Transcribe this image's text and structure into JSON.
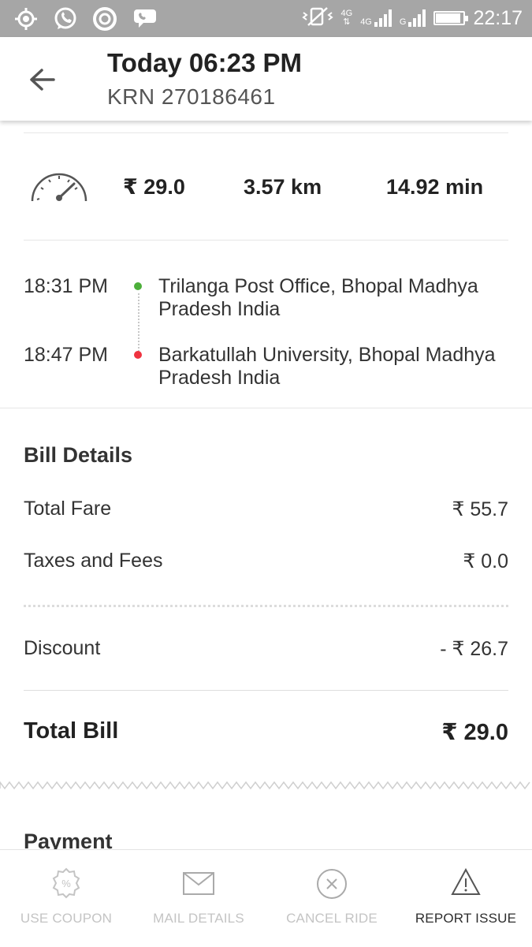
{
  "status_bar": {
    "time": "22:17",
    "network_1": "4G",
    "network_2": "4G",
    "network_3": "G",
    "battery_level": 0.9,
    "icons": [
      "location-icon",
      "whatsapp-icon",
      "sync-icon",
      "chat-icon",
      "vibrate-icon"
    ]
  },
  "header": {
    "title": "Today 06:23 PM",
    "subtitle": "KRN 270186461"
  },
  "ride_stats": {
    "fare": "₹ 29.0",
    "distance": "3.57 km",
    "duration": "14.92 min"
  },
  "trip": {
    "pickup": {
      "time": "18:31 PM",
      "address": "Trilanga Post Office, Bhopal Madhya Pradesh India",
      "color": "#4caf3a"
    },
    "drop": {
      "time": "18:47 PM",
      "address": "Barkatullah University, Bhopal Madhya Pradesh India",
      "color": "#ef3340"
    }
  },
  "bill": {
    "title": "Bill Details",
    "rows": [
      {
        "label": "Total Fare",
        "value": "₹ 55.7"
      },
      {
        "label": "Taxes and Fees",
        "value": "₹ 0.0"
      },
      {
        "label": "Discount",
        "value": "- ₹ 26.7"
      }
    ],
    "total_label": "Total Bill",
    "total_value": "₹ 29.0"
  },
  "payment": {
    "title": "Payment"
  },
  "actions": [
    {
      "label": "USE COUPON",
      "icon": "coupon-icon",
      "enabled": false
    },
    {
      "label": "MAIL DETAILS",
      "icon": "mail-icon",
      "enabled": false
    },
    {
      "label": "CANCEL RIDE",
      "icon": "cancel-icon",
      "enabled": false
    },
    {
      "label": "REPORT ISSUE",
      "icon": "warning-icon",
      "enabled": true
    }
  ]
}
